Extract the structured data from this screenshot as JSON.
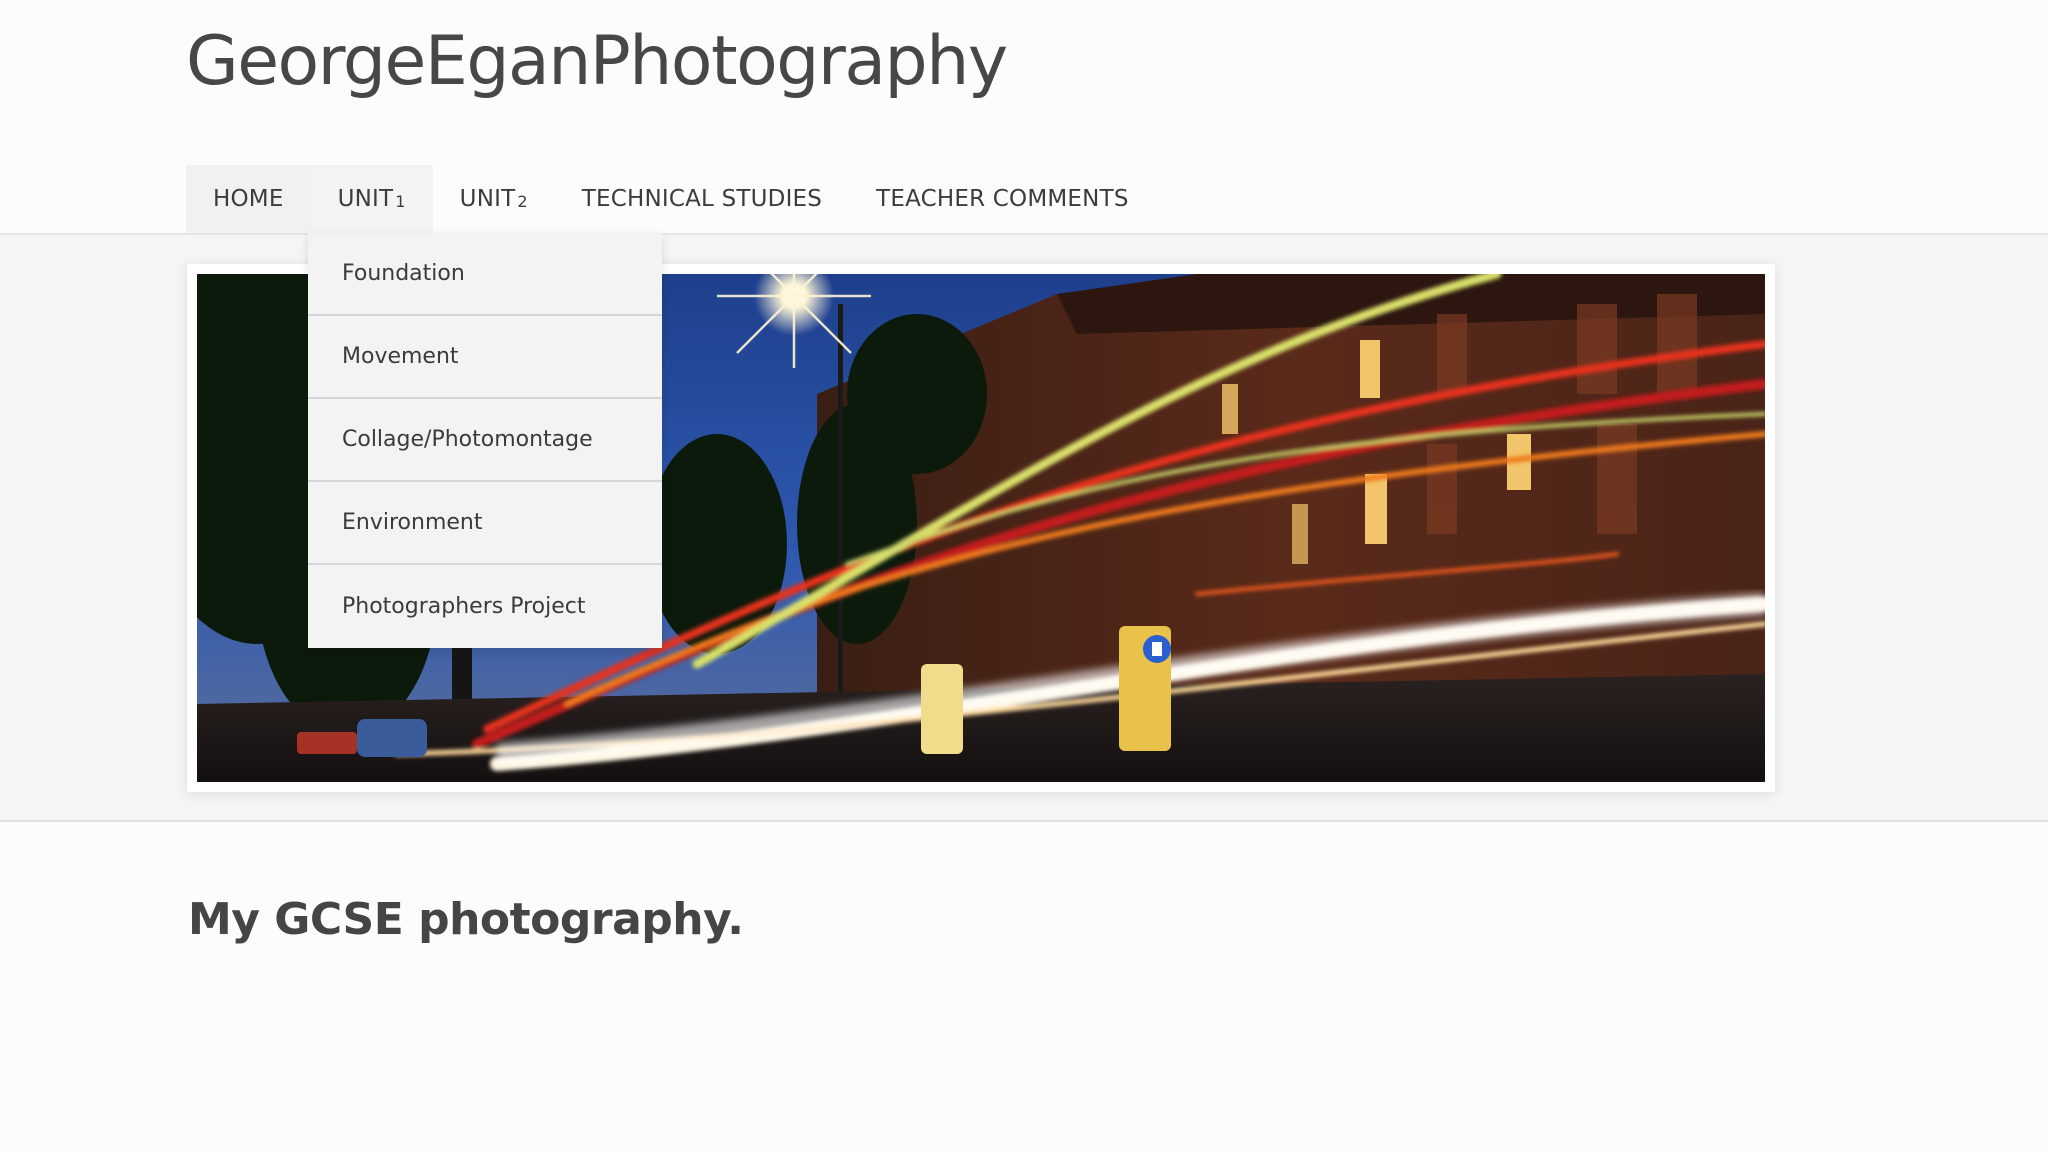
{
  "site": {
    "title": "GeorgeEganPhotography"
  },
  "nav": {
    "items": [
      {
        "label": "HOME"
      },
      {
        "label": "UNIT",
        "suffix": "1"
      },
      {
        "label": "UNIT",
        "suffix": "2"
      },
      {
        "label": "TECHNICAL STUDIES"
      },
      {
        "label": "TEACHER COMMENTS"
      }
    ]
  },
  "dropdown": {
    "items": [
      {
        "label": "Foundation"
      },
      {
        "label": "Movement"
      },
      {
        "label": "Collage/Photomontage"
      },
      {
        "label": "Environment"
      },
      {
        "label": "Photographers Project"
      }
    ]
  },
  "content": {
    "title": "My GCSE photography."
  },
  "colors": {
    "page_bg": "#fcfcfd",
    "band_bg": "#f5f5f6",
    "nav_active_bg": "#f3f3f4",
    "text": "#3c3c3c"
  }
}
